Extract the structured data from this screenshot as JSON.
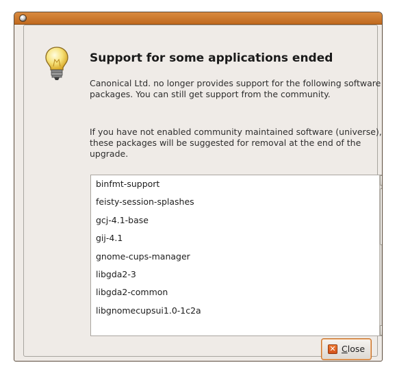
{
  "dialog": {
    "heading": "Support for some applications ended",
    "paragraph1": "Canonical Ltd. no longer provides support for the following software packages. You can still get support from the community.",
    "paragraph2": "If you have not enabled community maintained software (universe), these packages will be suggested for removal at the end of the upgrade.",
    "packages": [
      "binfmt-support",
      "feisty-session-splashes",
      "gcj-4.1-base",
      "gij-4.1",
      "gnome-cups-manager",
      "libgda2-3",
      "libgda2-common",
      "libgnomecupsui1.0-1c2a"
    ],
    "close_mnemonic": "C",
    "close_rest": "lose"
  },
  "icons": {
    "window": "window-icon",
    "dialog": "lightbulb-icon",
    "close": "close-icon",
    "scroll_up": "scroll-up-arrow-icon",
    "scroll_down": "scroll-down-arrow-icon"
  },
  "colors": {
    "titlebar": "#c9772f",
    "dialog_bg": "#efebe7",
    "button_focus": "#c7722a"
  }
}
